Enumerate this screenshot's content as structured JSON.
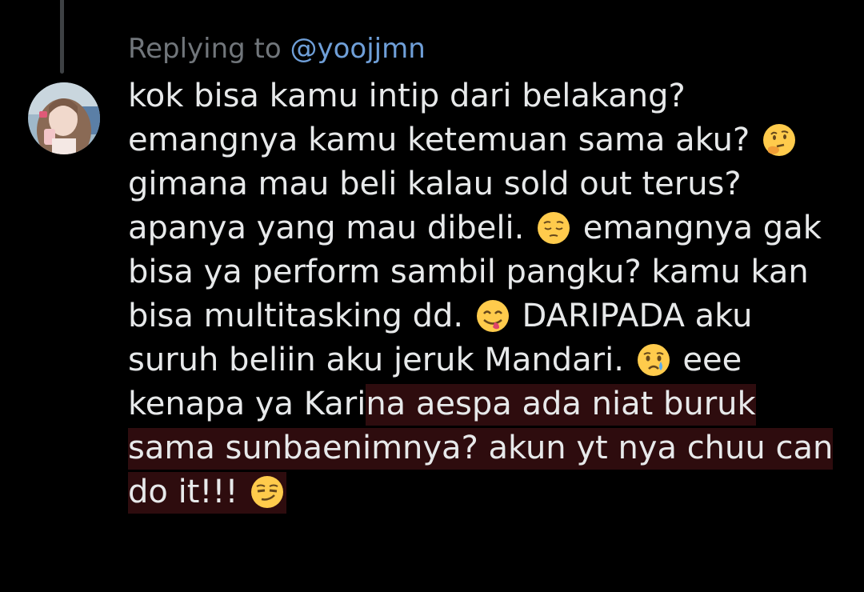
{
  "reply": {
    "prefix": "Replying to ",
    "handle": "@yoojjmn"
  },
  "tweet": {
    "lines": [
      [
        "kok bisa kamu intip dari belakang?"
      ],
      [
        "emangnya kamu ketemuan sama aku? "
      ],
      [
        "gimana mau beli kalau sold out terus?"
      ],
      [
        "apanya yang mau dibeli. ",
        " emangnya gak"
      ],
      [
        "bisa ya perform sambil pangku? kamu kan"
      ],
      [
        "bisa multitasking dd. ",
        " DARIPADA aku"
      ],
      [
        "suruh beliin aku jeruk Mandari. ",
        " eee"
      ],
      [
        "kenapa ya Kari",
        "na aespa ada niat buruk"
      ],
      [
        "sama sunbaenimnya? akun yt nya chuu can"
      ],
      [
        "do it!!! "
      ]
    ],
    "emojis": [
      "thinking-face",
      "pensive-face",
      "yum-face",
      "crying-face",
      "smirking-face"
    ],
    "highlight_color": "#2e0c0e"
  },
  "colors": {
    "background": "#000000",
    "text": "#e7e9ea",
    "muted": "#71767b",
    "link": "#6f9fd8"
  }
}
